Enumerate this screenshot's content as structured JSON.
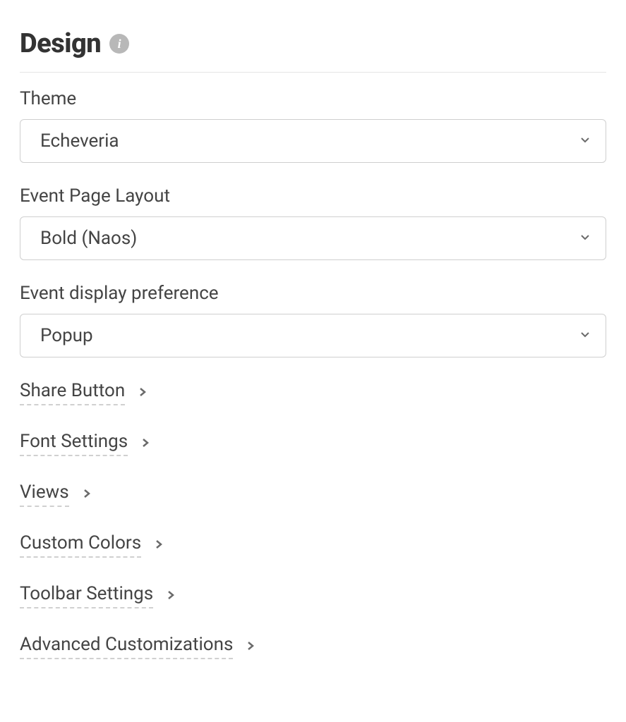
{
  "section": {
    "title": "Design"
  },
  "fields": {
    "theme": {
      "label": "Theme",
      "value": "Echeveria"
    },
    "eventPageLayout": {
      "label": "Event Page Layout",
      "value": "Bold (Naos)"
    },
    "eventDisplayPreference": {
      "label": "Event display preference",
      "value": "Popup"
    }
  },
  "expandables": {
    "shareButton": "Share Button",
    "fontSettings": "Font Settings",
    "views": "Views",
    "customColors": "Custom Colors",
    "toolbarSettings": "Toolbar Settings",
    "advancedCustomizations": "Advanced Customizations"
  }
}
